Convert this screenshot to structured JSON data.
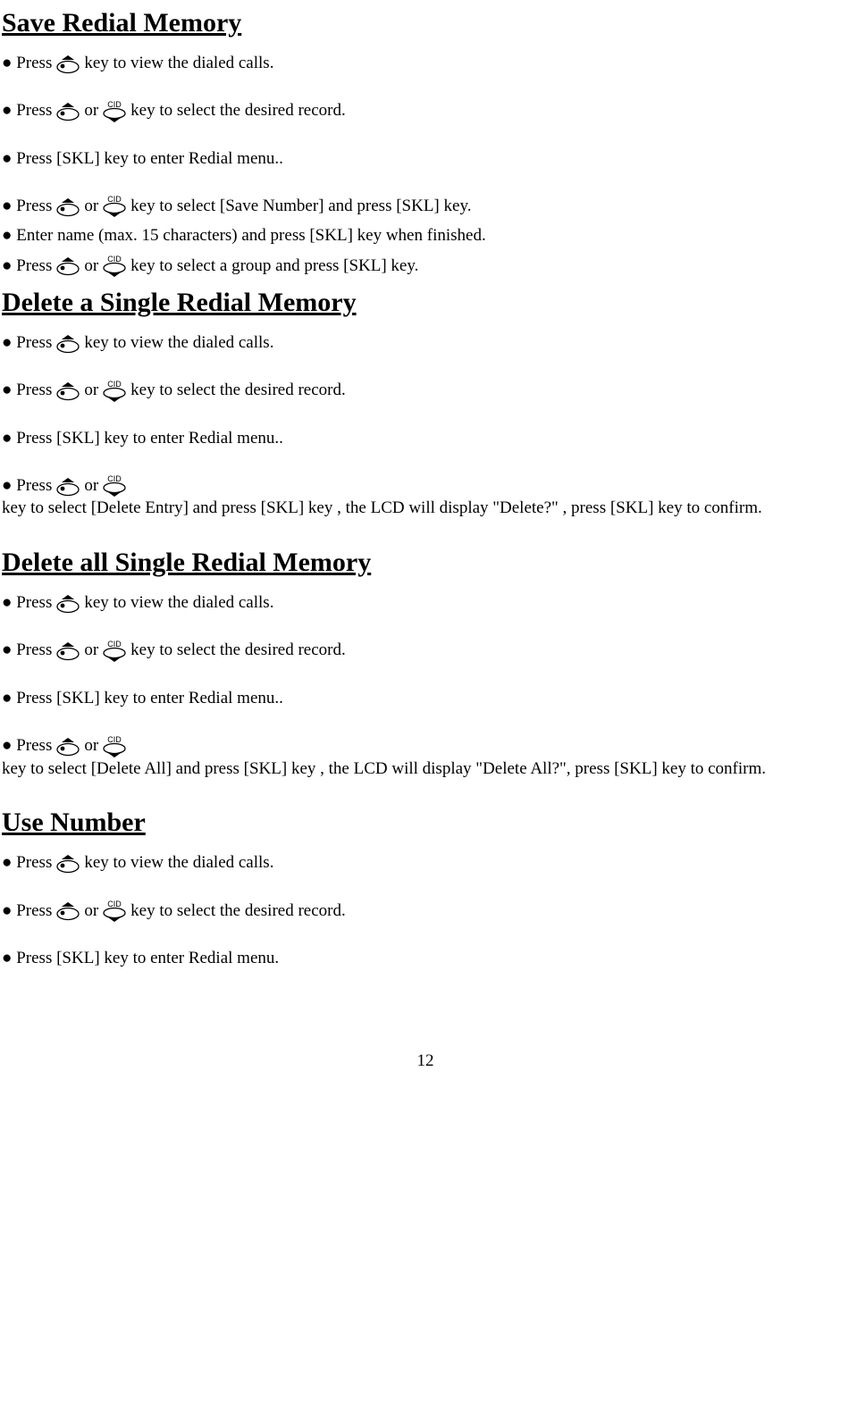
{
  "sections": [
    {
      "title": "Save Redial Memory",
      "items": [
        {
          "parts": [
            "●  Press ",
            {
              "icon": "redial"
            },
            " key to view the dialed calls."
          ],
          "tight": false
        },
        {
          "parts": [
            "●  Press ",
            {
              "icon": "redial"
            },
            " or ",
            {
              "icon": "cid"
            },
            " key to select the desired record."
          ],
          "tight": false
        },
        {
          "parts": [
            "● Press [SKL] key to enter Redial menu.."
          ],
          "tight": false
        },
        {
          "parts": [
            "● Press ",
            {
              "icon": "redial"
            },
            " or ",
            {
              "icon": "cid"
            },
            " key to select [Save Number] and press  [SKL] key."
          ],
          "tight": true
        },
        {
          "parts": [
            "● Enter name (max. 15 characters) and press [SKL] key when finished."
          ],
          "tight": true
        },
        {
          "parts": [
            "●  Press ",
            {
              "icon": "redial"
            },
            " or ",
            {
              "icon": "cid"
            },
            " key to select a group and press [SKL] key."
          ],
          "tight": true
        }
      ]
    },
    {
      "title": "Delete a Single Redial Memory",
      "items": [
        {
          "parts": [
            "●  Press ",
            {
              "icon": "redial"
            },
            " key to view the dialed calls."
          ],
          "tight": false
        },
        {
          "parts": [
            "●  Press ",
            {
              "icon": "redial"
            },
            " or ",
            {
              "icon": "cid"
            },
            " key to select the desired record."
          ],
          "tight": false
        },
        {
          "parts": [
            "● Press [SKL] key to enter Redial menu.."
          ],
          "tight": false
        },
        {
          "parts": [
            "● Press ",
            {
              "icon": "redial"
            },
            " or ",
            {
              "icon": "cid"
            },
            " key to select [Delete Entry] and press  [SKL] key , the LCD will display \"Delete?\" , press  [SKL] key to confirm."
          ],
          "tight": false
        }
      ]
    },
    {
      "title": "Delete all Single Redial Memory",
      "items": [
        {
          "parts": [
            "●  Press ",
            {
              "icon": "redial"
            },
            " key to view the dialed calls."
          ],
          "tight": false
        },
        {
          "parts": [
            "●  Press ",
            {
              "icon": "redial"
            },
            " or ",
            {
              "icon": "cid"
            },
            " key to select the desired record."
          ],
          "tight": false
        },
        {
          "parts": [
            "● Press [SKL] key to enter Redial menu.."
          ],
          "tight": false
        },
        {
          "parts": [
            "● Press ",
            {
              "icon": "redial"
            },
            " or ",
            {
              "icon": "cid"
            },
            " key to select [Delete All] and press  [SKL] key , the LCD will display \"Delete All?\", press [SKL] key to confirm."
          ],
          "tight": false
        }
      ]
    },
    {
      "title": "Use Number",
      "items": [
        {
          "parts": [
            "●  Press ",
            {
              "icon": "redial"
            },
            " key to view the dialed calls."
          ],
          "tight": false
        },
        {
          "parts": [
            "●  Press ",
            {
              "icon": "redial"
            },
            " or ",
            {
              "icon": "cid"
            },
            " key to select the desired record."
          ],
          "tight": false
        },
        {
          "parts": [
            "● Press [SKL] key to enter Redial menu."
          ],
          "tight": false
        }
      ]
    }
  ],
  "page_number": "12"
}
